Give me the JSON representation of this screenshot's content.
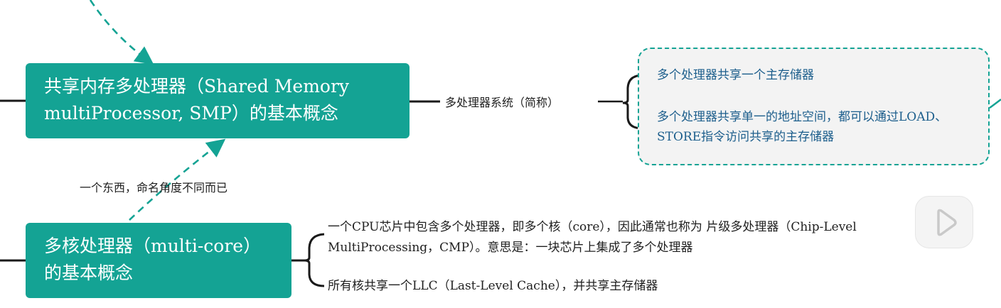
{
  "nodes": {
    "smp": {
      "title": "共享内存多处理器（Shared Memory multiProcessor, SMP）的基本概念",
      "edge_label": "多处理器系统（简称）",
      "details": [
        "多个处理器共享一个主存储器",
        "多个处理器共享单一的地址空间，都可以通过LOAD、STORE指令访问共享的主存储器"
      ]
    },
    "multicore": {
      "title": "多核处理器（multi-core）的基本概念",
      "details": [
        "一个CPU芯片中包含多个处理器，即多个核（core），因此通常也称为 片级多处理器（Chip-Level MultiProcessing，CMP）。意思是：一块芯片上集成了多个处理器",
        "所有核共享一个LLC（Last-Level Cache），并共享主存储器"
      ]
    },
    "relation_label": "一个东西，命名角度不同而已"
  },
  "colors": {
    "node_fill": "#14a394",
    "dashed_border": "#14a394",
    "box_text": "#1c5e8c",
    "line": "#1a1a1a"
  },
  "icons": {
    "play": "play-icon"
  }
}
